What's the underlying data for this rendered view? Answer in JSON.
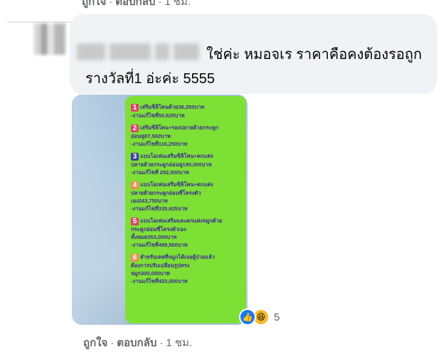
{
  "top_actions": {
    "like": "ถูกใจ",
    "reply": "ตอบกลับ",
    "time": "1 ชม.",
    "sep": "·"
  },
  "comment": {
    "text_line1": "ใช่ค่ะ หมอจเร ราคาคือคงต้องรอถูก",
    "text_line2": "รางวัลที่1 อ่ะค่ะ 5555"
  },
  "image_items": [
    {
      "num": "1",
      "num_color": "#e0416b",
      "lines": [
        "เสริมซิลิโคนด้วย36,250บาท",
        "-งานแก้ไขที่50,625บาท"
      ]
    },
    {
      "num": "2",
      "num_color": "#e0416b",
      "lines": [
        "เสริมซิลิโคน+รองปลายด้วยกระดูก",
        "อ่อนหู87,500บาท",
        "-งานแก้ไขที่116,250บาท"
      ]
    },
    {
      "num": "3",
      "num_color": "#3b3fa0",
      "lines": [
        "แบบโอเพ่นเสริมซิลิโคน+ตกแต่ง",
        "ปลายด้วยกระดูกอ่อนหู195,000บาท",
        "-งานแก้ไขที่ 252,500บาท"
      ]
    },
    {
      "num": "4",
      "num_color": "#f08a5d",
      "lines": [
        "แบบโอเพ่นเสริมซิลิโคน+ตกแต่ง",
        "ปลายด้วยกระดูกอ่อนซี่โครงตัว",
        "เอง243,750บาท",
        "-งานแก้ไขที่335,625บาท"
      ]
    },
    {
      "num": "5",
      "num_color": "#e0416b",
      "lines": [
        "แบบโอเพ่นเสริมและตกแต่งจมูกด้วย",
        "กระดูกอ่อนซี่โครงตัวเอง",
        "ทั้งหมด353,000บาท",
        "-งานแก้ไขที่499,500บาท"
      ]
    },
    {
      "num": "6",
      "num_color": "#f08a5d",
      "lines": [
        "สำหรับเคสที่จมูกได้เจอผู้ป่วยแล้ว",
        "ต้องการปรับเปลี่ยนรูปทรง",
        "จมูก300,000บาท",
        "-งานแก้ไขที่420,000บาท"
      ]
    }
  ],
  "reactions": {
    "types": [
      "like-icon",
      "haha-icon"
    ],
    "count": "5",
    "like_color": "#1877f2",
    "haha_color": "#f7b928"
  },
  "bottom_actions": {
    "like": "ถูกใจ",
    "reply": "ตอบกลับ",
    "time": "1 ชม.",
    "sep": "·"
  }
}
